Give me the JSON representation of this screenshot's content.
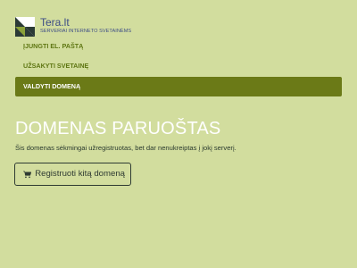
{
  "brand": {
    "name": "Tera.lt",
    "tagline": "SERVERIAI INTERNETO SVETAINĖMS"
  },
  "nav": {
    "items": [
      {
        "label": "ĮJUNGTI EL. PAŠTĄ",
        "active": false
      },
      {
        "label": "UŽSAKYTI SVETAINĘ",
        "active": false
      },
      {
        "label": "VALDYTI DOMENĄ",
        "active": true
      }
    ]
  },
  "main": {
    "title": "DOMENAS PARUOŠTAS",
    "description": "Šis domenas sėkmingai užregistruotas, bet dar nenukreiptas į jokį serverį.",
    "button_label": "Registruoti kitą domeną",
    "button_icon": "shopping-cart-icon"
  },
  "colors": {
    "background": "#d2dd9e",
    "accent": "#6b7a17",
    "nav_text": "#5e7612",
    "brand_text": "#3d4d86"
  }
}
